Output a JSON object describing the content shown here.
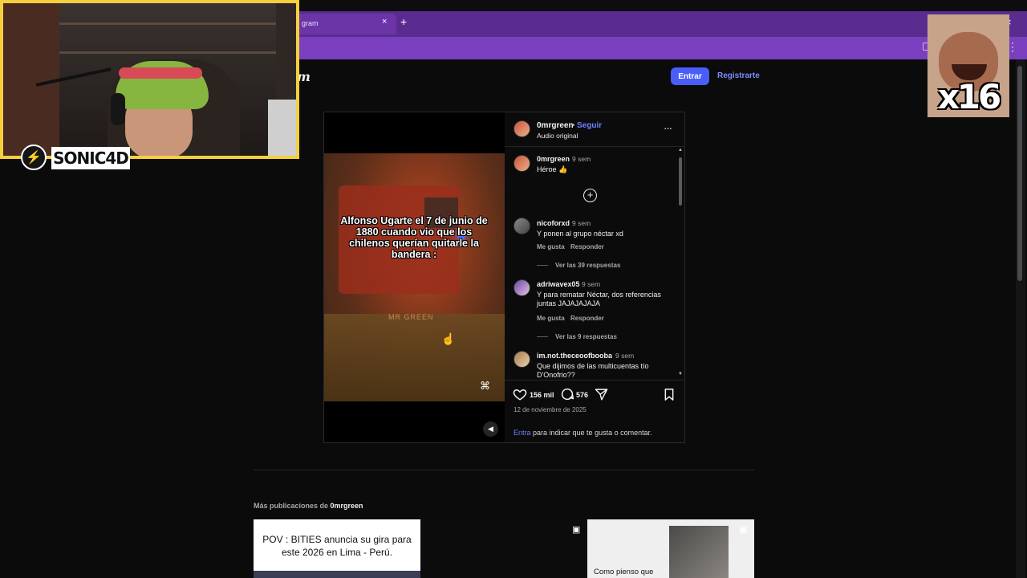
{
  "browser": {
    "tab_title": "gram",
    "tab_close": "×",
    "new_tab": "+",
    "window_close": "×",
    "menu": "⋮"
  },
  "header": {
    "brand_fragment": "m",
    "login_label": "Entrar",
    "signup_label": "Registrarte"
  },
  "post": {
    "username": "0mrgreen",
    "dot": "•",
    "follow_label": "Seguir",
    "audio": "Audio original",
    "more": "···",
    "video": {
      "caption": "Alfonso Ugarte el 7 de junio de 1880 cuando vio que los chilenos querían quitarle la bandera :",
      "watermark": "MR GREEN"
    },
    "caption_comment": {
      "username": "0mrgreen",
      "time": "9 sem",
      "text": "Héroe 👍"
    },
    "comments": [
      {
        "username": "nicoforxd",
        "time": "9 sem",
        "text": "Y ponen al grupo néctar xd",
        "like": "Me gusta",
        "reply": "Responder",
        "view_replies": "Ver las 39 respuestas"
      },
      {
        "username": "adriwavex05",
        "time": "9 sem",
        "text": "Y para rematar Néctar, dos referencias juntas JAJAJAJAJA",
        "like": "Me gusta",
        "reply": "Responder",
        "view_replies": "Ver las 9 respuestas"
      },
      {
        "username": "im.not.theceoofbooba",
        "time": "9 sem",
        "text": "Que dijimos de las multicuentas tío D'Onofrio??"
      }
    ],
    "likes": "156 mil",
    "comments_count": "576",
    "date": "12 de noviembre de 2025",
    "login_prompt_link": "Entra",
    "login_prompt_rest": " para indicar que te gusta o comentar."
  },
  "more_posts": {
    "prefix": "Más publicaciones de ",
    "username": "0mrgreen",
    "thumbnails": [
      {
        "text": "POV : BITIES anuncia su gira para este 2026 en Lima - Perú."
      },
      {
        "text": ""
      },
      {
        "text": "Como pienso que"
      }
    ]
  },
  "overlay": {
    "streamer_name": "SONIC4D",
    "speed_label": "x16"
  },
  "colors": {
    "accent": "#4a5df9",
    "link": "#6d82ff",
    "chrome_purple": "#5a2c8f",
    "cam_border": "#f4d03f"
  }
}
